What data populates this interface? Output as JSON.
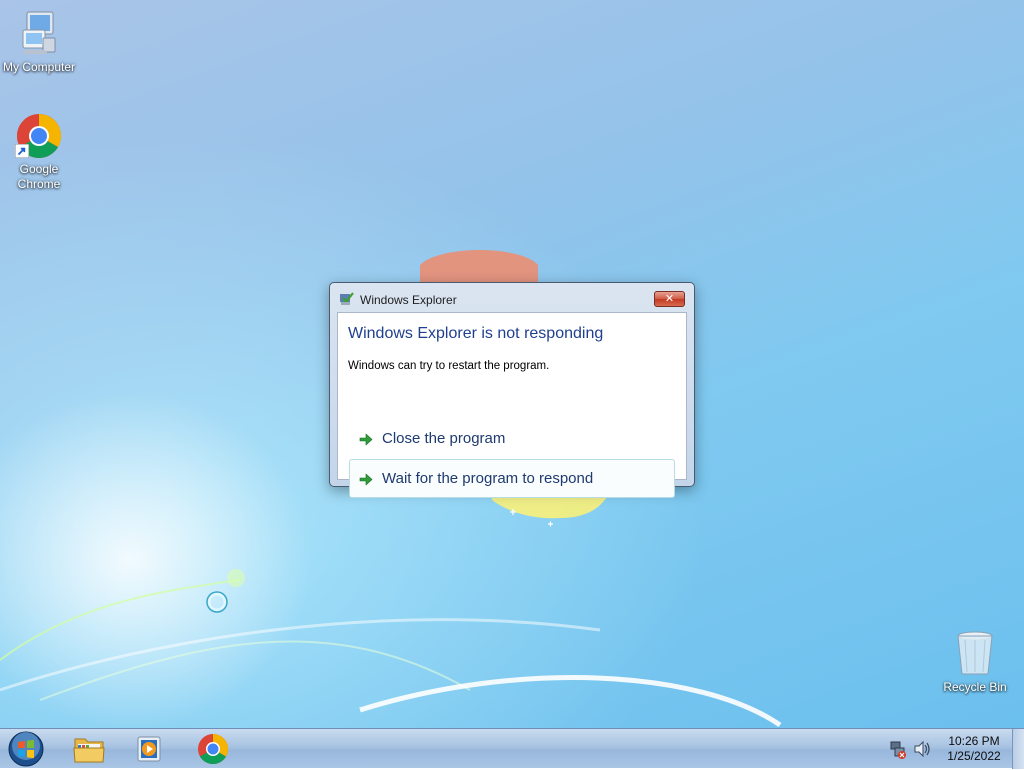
{
  "desktop": {
    "icons": [
      {
        "label": "My Computer",
        "icon": "computer-icon"
      },
      {
        "label": "Google Chrome",
        "label_line1": "Google",
        "label_line2": "Chrome",
        "icon": "chrome-icon"
      },
      {
        "label": "Recycle Bin",
        "icon": "recycle-bin-icon"
      }
    ]
  },
  "dialog": {
    "title": "Windows Explorer",
    "heading": "Windows Explorer is not responding",
    "message": "Windows can try to restart the program.",
    "options": [
      {
        "label": "Close the program",
        "icon": "green-arrow-icon"
      },
      {
        "label": "Wait for the program to respond",
        "icon": "green-arrow-icon",
        "focused": true
      }
    ],
    "close_glyph": "✕"
  },
  "taskbar": {
    "pinned": [
      {
        "name": "Windows Explorer",
        "icon": "folder-icon"
      },
      {
        "name": "Windows Media Player",
        "icon": "media-player-icon"
      },
      {
        "name": "Google Chrome",
        "icon": "chrome-icon"
      }
    ],
    "tray": {
      "icons": [
        "network-icon",
        "volume-icon"
      ],
      "time": "10:26 PM",
      "date": "1/25/2022"
    }
  },
  "colors": {
    "heading": "#1f3f8f",
    "taskbar": "#a8c3e2",
    "close_button": "#c13a24"
  }
}
